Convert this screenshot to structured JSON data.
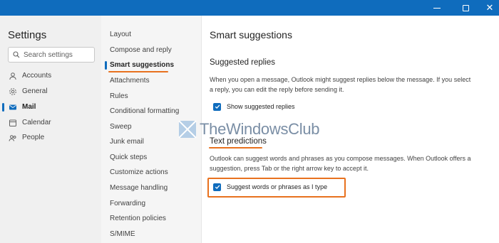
{
  "window": {
    "minimize_icon": "minimize-icon",
    "maximize_icon": "maximize-icon",
    "close_icon": "close-icon",
    "close_symbol": "✕",
    "titlebar_color": "#0f6cbd"
  },
  "settings": {
    "title": "Settings",
    "search_placeholder": "Search settings",
    "categories": [
      {
        "label": "Accounts",
        "icon": "person-icon",
        "active": false
      },
      {
        "label": "General",
        "icon": "gear-icon",
        "active": false
      },
      {
        "label": "Mail",
        "icon": "mail-icon",
        "active": true
      },
      {
        "label": "Calendar",
        "icon": "calendar-icon",
        "active": false
      },
      {
        "label": "People",
        "icon": "people-icon",
        "active": false
      }
    ]
  },
  "mail_nav": {
    "items": [
      {
        "label": "Layout",
        "active": false
      },
      {
        "label": "Compose and reply",
        "active": false
      },
      {
        "label": "Smart suggestions",
        "active": true
      },
      {
        "label": "Attachments",
        "active": false
      },
      {
        "label": "Rules",
        "active": false
      },
      {
        "label": "Conditional formatting",
        "active": false
      },
      {
        "label": "Sweep",
        "active": false
      },
      {
        "label": "Junk email",
        "active": false
      },
      {
        "label": "Quick steps",
        "active": false
      },
      {
        "label": "Customize actions",
        "active": false
      },
      {
        "label": "Message handling",
        "active": false
      },
      {
        "label": "Forwarding",
        "active": false
      },
      {
        "label": "Retention policies",
        "active": false
      },
      {
        "label": "S/MIME",
        "active": false
      }
    ]
  },
  "content": {
    "title": "Smart suggestions",
    "suggested_replies": {
      "heading": "Suggested replies",
      "line1": "When you open a message, Outlook might suggest replies below the message. If you select",
      "line2": "a reply, you can edit the reply before sending it.",
      "checkbox_label": "Show suggested replies",
      "checked": true
    },
    "text_predictions": {
      "heading": "Text predictions",
      "line1": "Outlook can suggest words and phrases as you compose messages. When Outlook offers a",
      "line2": "suggestion, press Tab or the right arrow key to accept it.",
      "checkbox_label": "Suggest words or phrases as I type",
      "checked": true
    }
  },
  "watermark": {
    "text": "TheWindowsClub"
  },
  "colors": {
    "accent": "#0f6cbd",
    "annotation": "#e8711e"
  }
}
